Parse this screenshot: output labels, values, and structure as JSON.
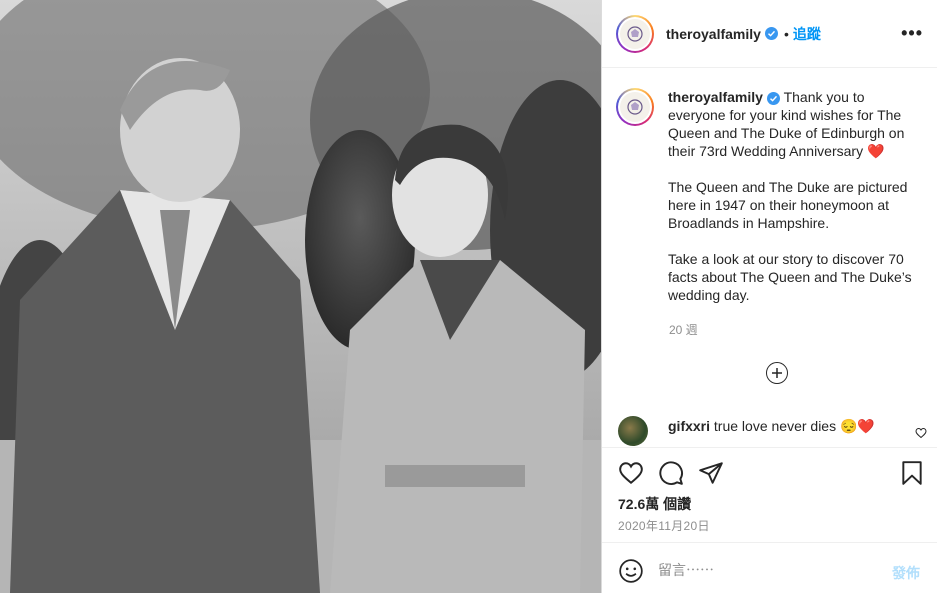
{
  "photo": {
    "description_icon": "black-and-white-couple-photo"
  },
  "header": {
    "username": "theroyalfamily",
    "separator": "•",
    "follow_label": "追蹤",
    "more_label": "•••"
  },
  "caption": {
    "username": "theroyalfamily",
    "paragraphs": [
      "Thank you to everyone for your kind wishes for The Queen and The Duke of Edinburgh on their 73rd Wedding Anniversary ❤️",
      "The Queen and The Duke are pictured here in 1947 on their honeymoon at Broadlands in Hampshire.",
      "Take a look at our story to discover 70 facts about The Queen and The Duke’s wedding day."
    ],
    "time_ago": "20 週"
  },
  "comment": {
    "username": "gifxxri",
    "text": "true love never dies 😔❤️"
  },
  "stats": {
    "likes": "72.6萬 個讚",
    "date": "2020年11月20日"
  },
  "composer": {
    "placeholder": "留言⋯⋯",
    "post_label": "發佈"
  },
  "colors": {
    "accent": "#0095f6",
    "verified": "#3897f0",
    "muted": "#8e8e8e",
    "post_disabled": "#b2dffc"
  }
}
